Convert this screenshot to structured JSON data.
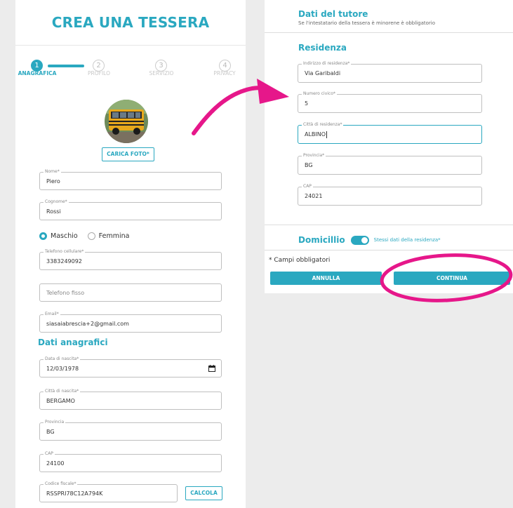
{
  "colors": {
    "accent": "#2aa8c0",
    "highlight": "#e6178a"
  },
  "left": {
    "title": "CREA UNA TESSERA",
    "steps": [
      {
        "num": "1",
        "label": "ANAGRAFICA"
      },
      {
        "num": "2",
        "label": "PROFILO"
      },
      {
        "num": "3",
        "label": "SERVIZIO"
      },
      {
        "num": "4",
        "label": "PRIVACY"
      }
    ],
    "upload_label": "CARICA FOTO*",
    "nome": {
      "label": "Nome*",
      "value": "Piero"
    },
    "cognome": {
      "label": "Cognome*",
      "value": "Rossi"
    },
    "gender": {
      "male": "Maschio",
      "female": "Femmina"
    },
    "cellulare": {
      "label": "Telefono cellulare*",
      "value": "3383249092"
    },
    "fisso": {
      "placeholder": "Telefono fisso"
    },
    "email": {
      "label": "Email*",
      "value": "siasaiabrescia+2@gmail.com"
    },
    "section_anagrafici": "Dati anagrafici",
    "nascita": {
      "label": "Data di nascita*",
      "value": "12/03/1978"
    },
    "citta_nascita": {
      "label": "Città di nascita*",
      "value": "BERGAMO"
    },
    "provincia": {
      "label": "Provincia",
      "value": "BG"
    },
    "cap": {
      "label": "CAP",
      "value": "24100"
    },
    "codice_fiscale": {
      "label": "Codice fiscale*",
      "value": "RSSPRI78C12A794K"
    },
    "calcola_label": "CALCOLA"
  },
  "right": {
    "tutor_title": "Dati del tutore",
    "tutor_sub": "Se l'intestatario della tessera è minorene è obbligatorio",
    "residenza_title": "Residenza",
    "indirizzo": {
      "label": "Indirizzo di residenza*",
      "value": "Via Garibaldi"
    },
    "civico": {
      "label": "Numero civico*",
      "value": "5"
    },
    "citta": {
      "label": "Città di residenza*",
      "value": "ALBINO"
    },
    "provincia": {
      "label": "Provincia*",
      "value": "BG"
    },
    "cap": {
      "label": "CAP",
      "value": "24021"
    },
    "domicilio_title": "Domicillio",
    "domicilio_toggle_label": "Stessi dati della residenza*",
    "required_note": "* Campi obbligatori",
    "annulla_label": "ANNULLA",
    "continua_label": "CONTINUA"
  }
}
